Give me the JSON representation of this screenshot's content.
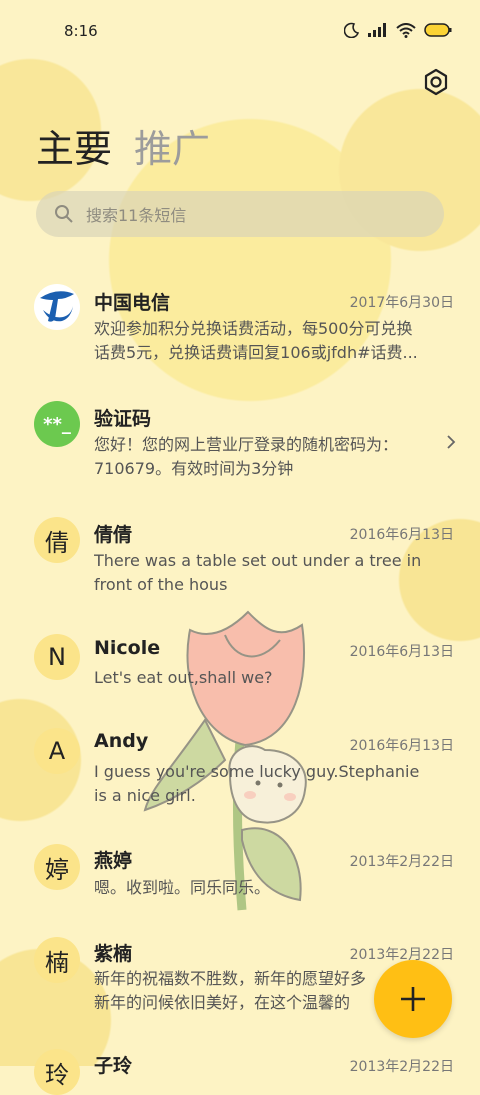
{
  "status_bar": {
    "time": "8:16",
    "icons": [
      "moon-icon",
      "signal-icon",
      "wifi-icon",
      "battery-icon"
    ]
  },
  "header": {
    "tabs": [
      {
        "label": "主要"
      },
      {
        "label": "推广"
      }
    ],
    "settings_icon": "gear-icon"
  },
  "search": {
    "placeholder": "搜索11条短信"
  },
  "conversations": [
    {
      "name": "中国电信",
      "date": "2017年6月30日",
      "avatar": "",
      "preview": [
        "欢迎参加积分兑换话费活动，每500分可兑换",
        "话费5元，兑换话费请回复106或jfdh#话费..."
      ]
    },
    {
      "name": "验证码",
      "date": "",
      "avatar": "**_",
      "preview": [
        "您好！您的网上营业厅登录的随机密码为：",
        "710679。有效时间为3分钟"
      ]
    },
    {
      "name": "倩倩",
      "date": "2016年6月13日",
      "avatar": "倩",
      "preview": [
        "There was a table set out under a tree in",
        "front of the hous"
      ]
    },
    {
      "name": "Nicole",
      "date": "2016年6月13日",
      "avatar": "N",
      "preview": [
        "Let's eat out,shall we?"
      ]
    },
    {
      "name": "Andy",
      "date": "2016年6月13日",
      "avatar": "A",
      "preview": [
        "I guess you're some lucky guy.Stephanie",
        "is a nice girl."
      ]
    },
    {
      "name": "燕婷",
      "date": "2013年2月22日",
      "avatar": "婷",
      "preview": [
        "嗯。收到啦。同乐同乐。"
      ]
    },
    {
      "name": "紫楠",
      "date": "2013年2月22日",
      "avatar": "楠",
      "preview": [
        "新年的祝福数不胜数，新年的愿望好多",
        "新年的问候依旧美好，在这个温馨的"
      ]
    },
    {
      "name": "子玲",
      "date": "2013年2月22日",
      "avatar": "玲",
      "preview": []
    }
  ],
  "fab": {
    "icon": "plus-icon"
  },
  "colors": {
    "accent": "#ffbf14",
    "avatar_bg": "#fbe48a",
    "verify_avatar": "#6cc94f",
    "telecom_blue": "#1b5fb0"
  }
}
